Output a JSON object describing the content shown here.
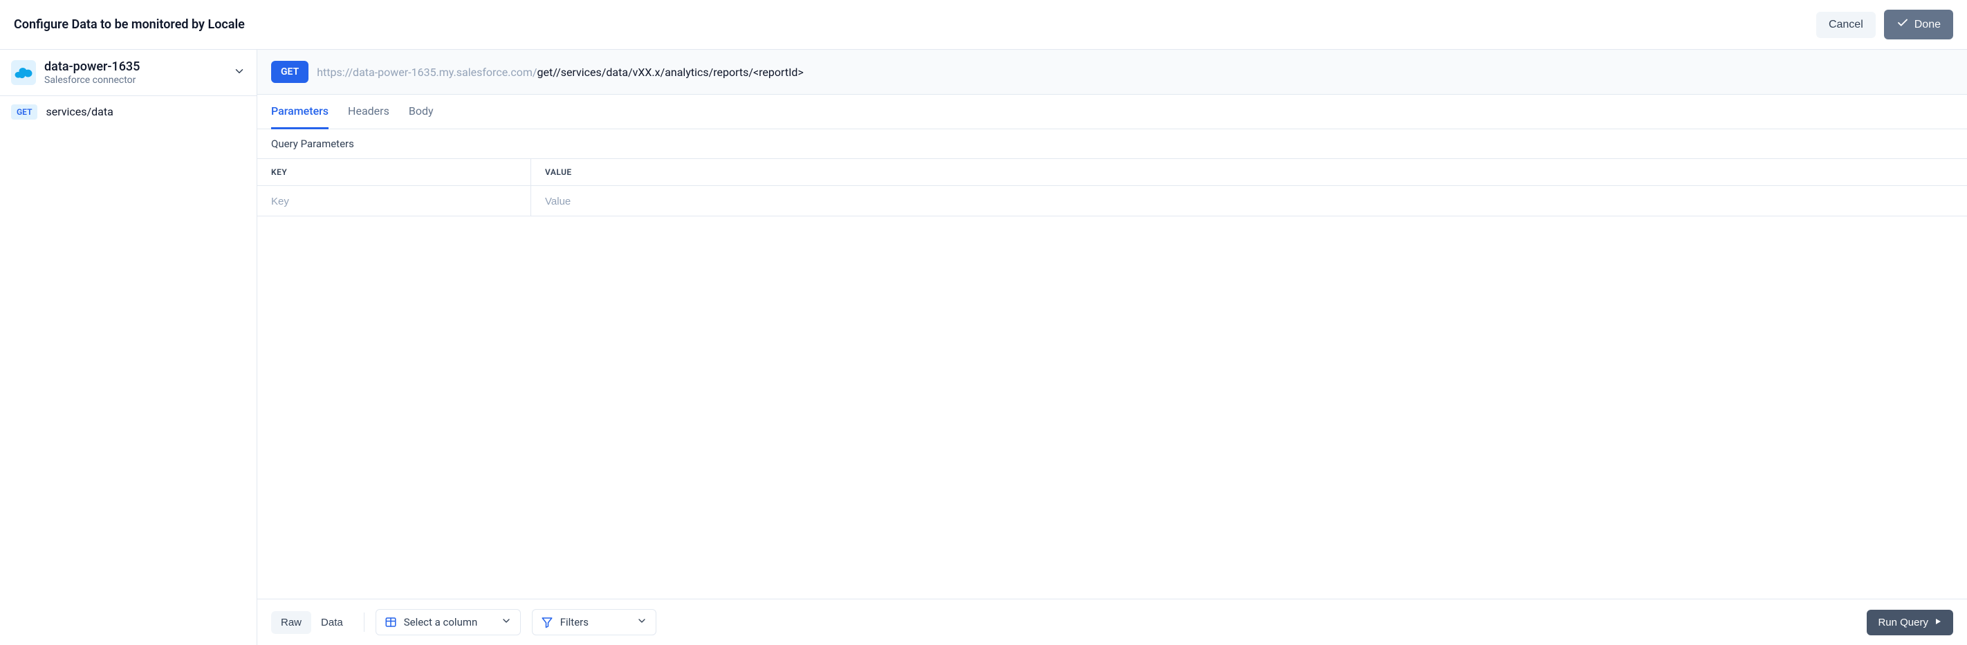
{
  "header": {
    "title": "Configure Data to be monitored by Locale",
    "cancel_label": "Cancel",
    "done_label": "Done"
  },
  "sidebar": {
    "connector": {
      "name": "data-power-1635",
      "subtitle": "Salesforce connector"
    },
    "endpoint": {
      "method": "GET",
      "label": "services/data"
    }
  },
  "request": {
    "method": "GET",
    "base_url": "https://data-power-1635.my.salesforce.com/",
    "path": "get//services/data/vXX.x/analytics/reports/<reportId>"
  },
  "tabs": {
    "parameters": "Parameters",
    "headers": "Headers",
    "body": "Body"
  },
  "params": {
    "section_title": "Query Parameters",
    "key_header": "KEY",
    "value_header": "VALUE",
    "key_placeholder": "Key",
    "value_placeholder": "Value"
  },
  "bottom": {
    "raw_label": "Raw",
    "data_label": "Data",
    "select_column_label": "Select a column",
    "filters_label": "Filters",
    "run_label": "Run Query"
  }
}
